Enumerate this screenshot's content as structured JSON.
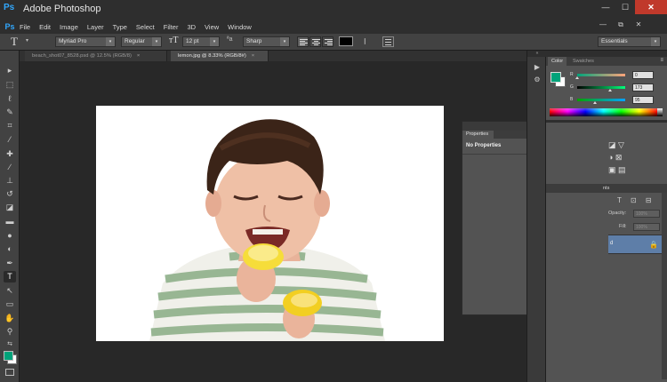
{
  "app": {
    "title": "Adobe Photoshop",
    "logo": "Ps"
  },
  "window_controls": {
    "minimize": "—",
    "maximize": "☐",
    "close": "✕"
  },
  "menu": {
    "items": [
      "File",
      "Edit",
      "Image",
      "Layer",
      "Type",
      "Select",
      "Filter",
      "3D",
      "View",
      "Window"
    ],
    "doc_controls": [
      "—",
      "⧉",
      "✕"
    ]
  },
  "options_bar": {
    "tool_glyph": "T",
    "font_family": "Myriad Pro",
    "font_style": "Regular",
    "size_glyph": "тT",
    "font_size": "12 pt",
    "aa_glyph": "ªa",
    "antialias": "Sharp",
    "text_color": "#000000",
    "warp_glyph": "ꞁ",
    "workspace": "Essentials"
  },
  "doc_tabs": [
    {
      "label": "beach_shot07_8528.psd @ 12.5% (RGB/8)",
      "close": "×",
      "active": false
    },
    {
      "label": "lemon.jpg @ 8.33% (RGB/8#)",
      "close": "×",
      "active": true
    }
  ],
  "tools": [
    {
      "name": "move-tool",
      "glyph": "▸"
    },
    {
      "name": "marquee-tool",
      "glyph": "⬚"
    },
    {
      "name": "lasso-tool",
      "glyph": "ℓ"
    },
    {
      "name": "quick-select-tool",
      "glyph": "✎"
    },
    {
      "name": "crop-tool",
      "glyph": "⌗"
    },
    {
      "name": "eyedropper-tool",
      "glyph": "⁄"
    },
    {
      "name": "healing-brush-tool",
      "glyph": "✚"
    },
    {
      "name": "brush-tool",
      "glyph": "∕"
    },
    {
      "name": "clone-stamp-tool",
      "glyph": "⊥"
    },
    {
      "name": "history-brush-tool",
      "glyph": "↺"
    },
    {
      "name": "eraser-tool",
      "glyph": "◪"
    },
    {
      "name": "gradient-tool",
      "glyph": "▬"
    },
    {
      "name": "blur-tool",
      "glyph": "●"
    },
    {
      "name": "dodge-tool",
      "glyph": "◐"
    },
    {
      "name": "pen-tool",
      "glyph": "✒"
    },
    {
      "name": "type-tool",
      "glyph": "T"
    },
    {
      "name": "path-select-tool",
      "glyph": "↖"
    },
    {
      "name": "shape-tool",
      "glyph": "▭"
    },
    {
      "name": "hand-tool",
      "glyph": "✋"
    },
    {
      "name": "zoom-tool",
      "glyph": "⚲"
    },
    {
      "name": "swap-colors",
      "glyph": "⇆"
    }
  ],
  "colors": {
    "foreground": "#00a37a",
    "background": "#ffffff"
  },
  "properties_panel": {
    "tab": "Properties",
    "message": "No Properties",
    "header_ctrls": "«  ✕",
    "menu": "≡"
  },
  "color_panel": {
    "tabs": [
      "Color",
      "Swatches"
    ],
    "menu": "≡",
    "channels": [
      {
        "label": "R",
        "value": "0",
        "fraction": 0.0
      },
      {
        "label": "G",
        "value": "173",
        "fraction": 0.68
      },
      {
        "label": "B",
        "value": "95",
        "fraction": 0.37
      }
    ]
  },
  "dock": {
    "collapse": "«",
    "icons": [
      "▶",
      "⚙"
    ]
  },
  "adjustments_panel": {
    "icon_rows": [
      "◪ ▽",
      "◑ ⊠",
      "▣ ▤"
    ]
  },
  "layers_panel": {
    "tab": "nts",
    "icon_row": "T ⊡ ⊟",
    "opacity_label": "Opacity:",
    "opacity_value": "100%",
    "fill_label": "Fill:",
    "fill_value": "100%",
    "layer_mark": "d",
    "lock_glyph": "🔒"
  }
}
